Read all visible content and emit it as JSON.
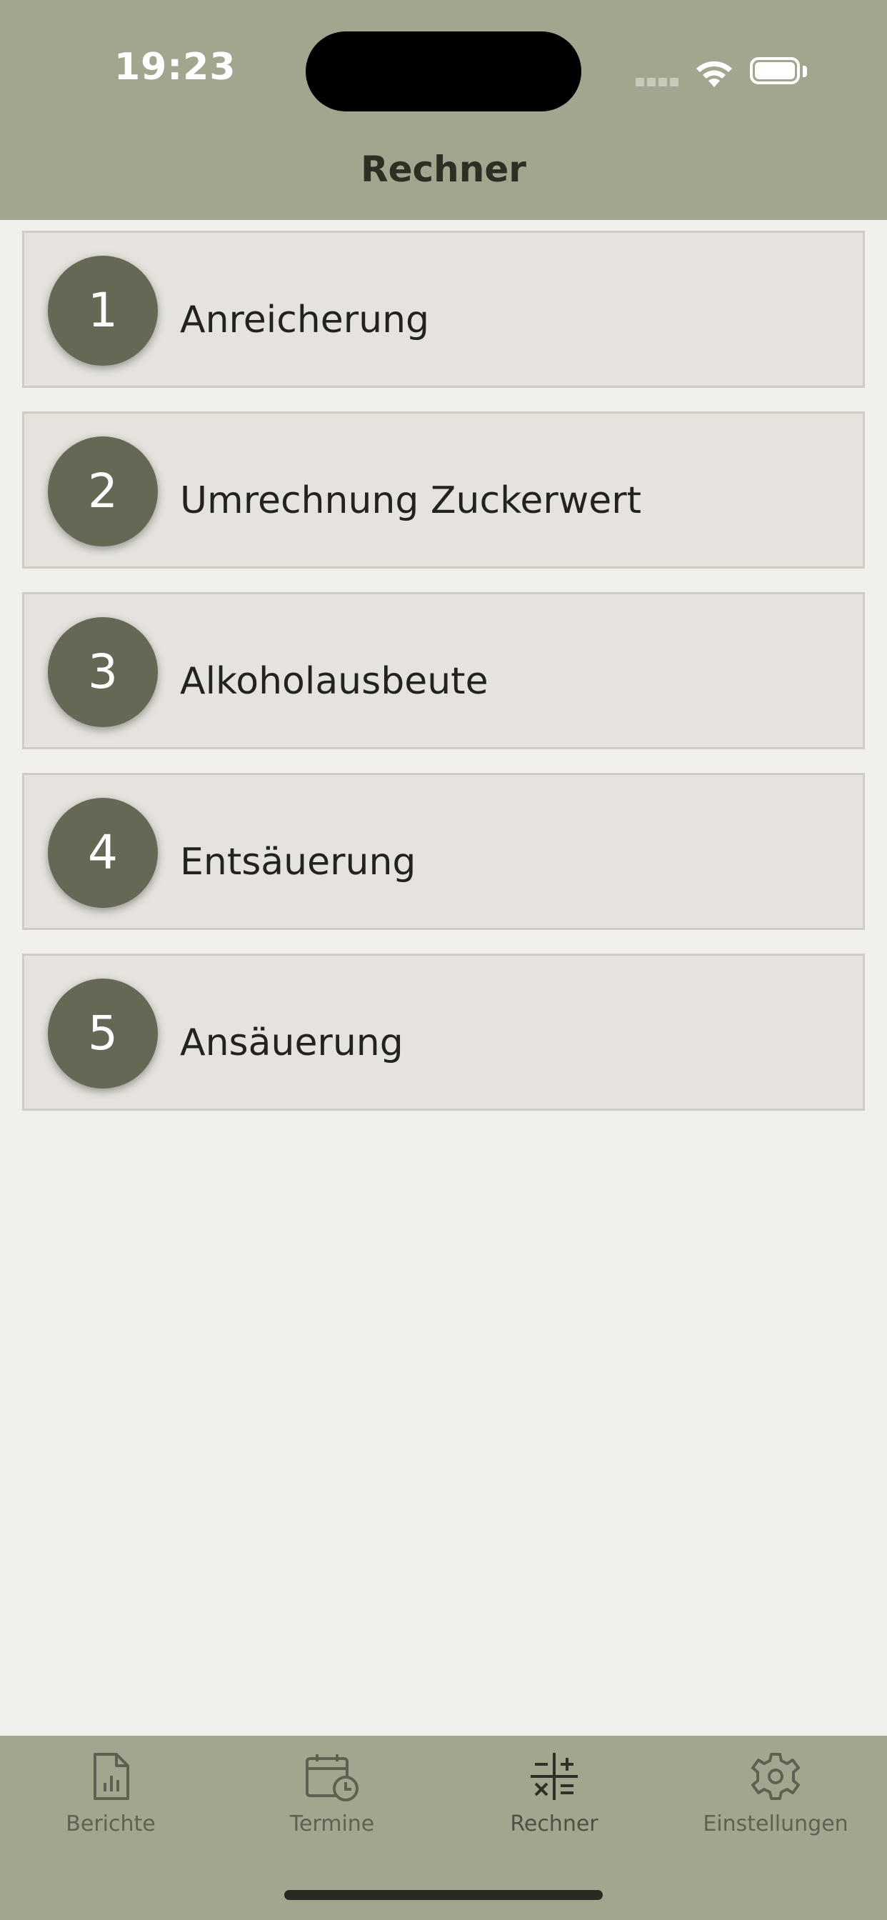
{
  "status_bar": {
    "time": "19:23"
  },
  "header": {
    "title": "Rechner"
  },
  "calculators": [
    {
      "number": "1",
      "label": "Anreicherung"
    },
    {
      "number": "2",
      "label": "Umrechnung Zuckerwert"
    },
    {
      "number": "3",
      "label": "Alkoholausbeute"
    },
    {
      "number": "4",
      "label": "Entsäuerung"
    },
    {
      "number": "5",
      "label": "Ansäuerung"
    }
  ],
  "tab_bar": {
    "tabs": [
      {
        "label": "Berichte",
        "icon": "document-chart-icon"
      },
      {
        "label": "Termine",
        "icon": "calendar-clock-icon"
      },
      {
        "label": "Rechner",
        "icon": "calculator-icon",
        "active": true
      },
      {
        "label": "Einstellungen",
        "icon": "gear-icon"
      }
    ]
  },
  "colors": {
    "header_bg": "#a4a58e",
    "badge_bg": "#666754",
    "row_bg": "#e6e3de",
    "page_bg": "#f1f0ed"
  }
}
